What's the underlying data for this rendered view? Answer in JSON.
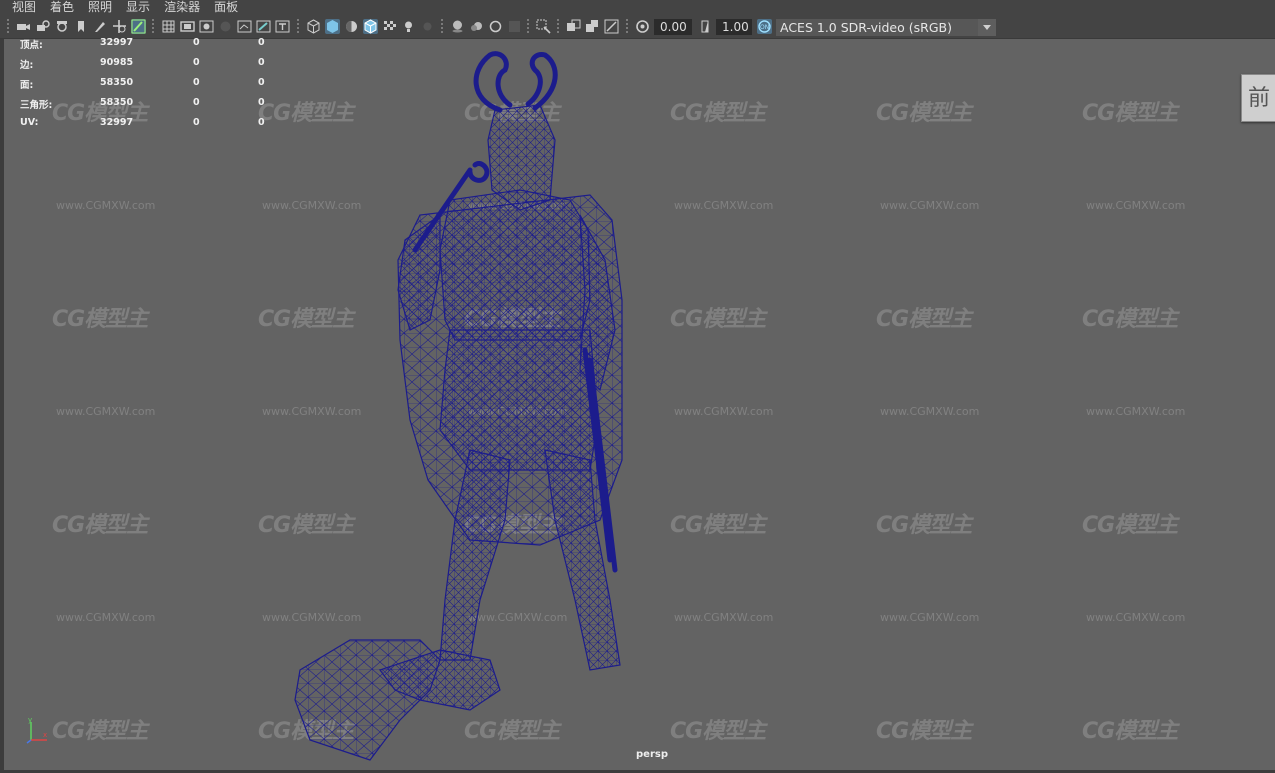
{
  "menu": [
    "视图",
    "着色",
    "照明",
    "显示",
    "渲染器",
    "面板"
  ],
  "toolbar": {
    "exposure_value": "0.00",
    "gamma_value": "1.00",
    "color_space": "ACES 1.0 SDR-video (sRGB)"
  },
  "hud": {
    "rows": [
      {
        "label": "顶点:",
        "value": "32997",
        "sel": "0",
        "comp": "0"
      },
      {
        "label": "边:",
        "value": "90985",
        "sel": "0",
        "comp": "0"
      },
      {
        "label": "面:",
        "value": "58350",
        "sel": "0",
        "comp": "0"
      },
      {
        "label": "三角形:",
        "value": "58350",
        "sel": "0",
        "comp": "0"
      },
      {
        "label": "UV:",
        "value": "32997",
        "sel": "0",
        "comp": "0"
      }
    ]
  },
  "camera_label": "persp",
  "view_cube_label": "前",
  "watermark": {
    "logo": "CG模型主",
    "url": "www.CGMXW.com"
  },
  "colors": {
    "wire": "#1c1c8c",
    "viewport_bg": "#636363",
    "accent": "#4d6f87"
  }
}
